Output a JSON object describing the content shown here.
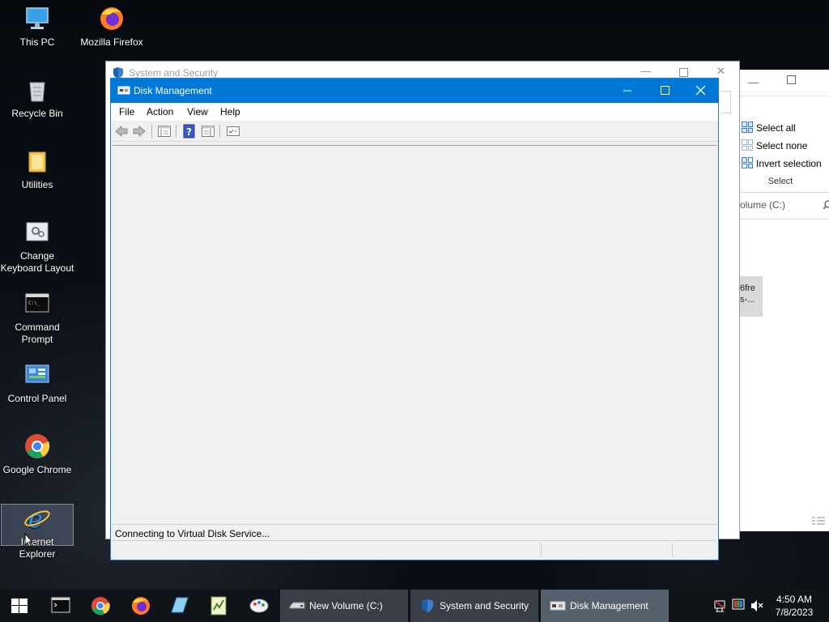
{
  "desktop": {
    "icons": [
      {
        "label": "This PC"
      },
      {
        "label": "Mozilla Firefox"
      },
      {
        "label": "Recycle Bin"
      },
      {
        "label": "Utilities"
      },
      {
        "label": "Change Keyboard Layout"
      },
      {
        "label": "Command Prompt"
      },
      {
        "label": "Control Panel"
      },
      {
        "label": "Google Chrome"
      },
      {
        "label": "Internet Explorer"
      }
    ]
  },
  "system_security_window": {
    "title": "System and Security"
  },
  "explorer_window": {
    "ribbon": {
      "select_all": "Select all",
      "select_none": "Select none",
      "invert_selection": "Invert selection",
      "group_label": "Select"
    },
    "address_fragment": "olume (C:)",
    "item_fragment_1": "6fre",
    "item_fragment_2": "s-..."
  },
  "disk_management": {
    "title": "Disk Management",
    "menu": [
      "File",
      "Action",
      "View",
      "Help"
    ],
    "status": "Connecting to Virtual Disk Service..."
  },
  "taskbar": {
    "buttons": [
      {
        "label": "New Volume (C:)"
      },
      {
        "label": "System and Security"
      },
      {
        "label": "Disk Management"
      }
    ],
    "clock": {
      "time": "4:50 AM",
      "date": "7/8/2023"
    }
  },
  "colors": {
    "titlebar": "#0078d7",
    "taskbar": "#101418",
    "taskbar_button": "#3a3f47",
    "taskbar_button_active": "#54606c"
  }
}
